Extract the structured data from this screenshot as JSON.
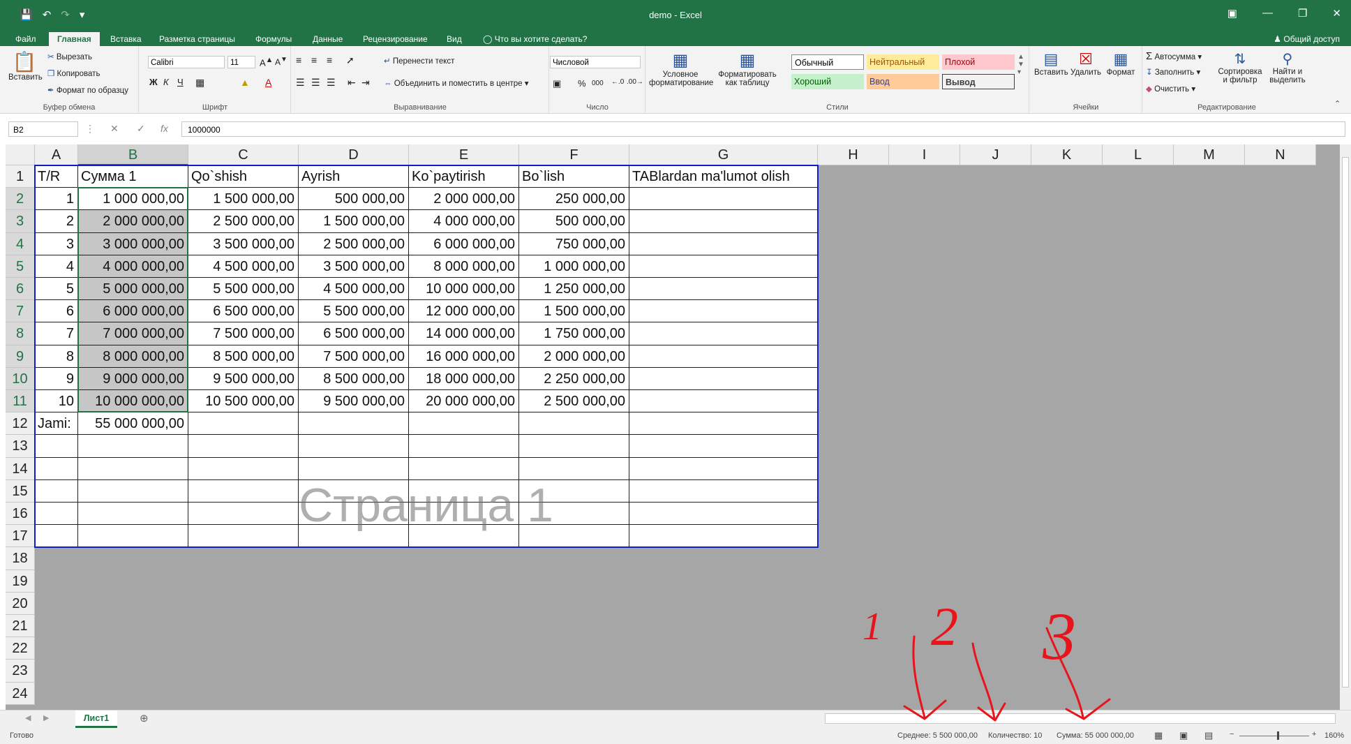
{
  "titlebar": {
    "title": "demo - Excel"
  },
  "tabs": [
    "Файл",
    "Главная",
    "Вставка",
    "Разметка страницы",
    "Формулы",
    "Данные",
    "Рецензирование",
    "Вид"
  ],
  "tellme": "Что вы хотите сделать?",
  "share": "Общий доступ",
  "ribbon": {
    "clipboard": {
      "paste": "Вставить",
      "cut": "Вырезать",
      "copy": "Копировать",
      "format_painter": "Формат по образцу",
      "label": "Буфер обмена"
    },
    "font": {
      "name": "Calibri",
      "size": "11",
      "bold": "Ж",
      "italic": "К",
      "underline": "Ч",
      "label": "Шрифт"
    },
    "alignment": {
      "wrap": "Перенести текст",
      "merge": "Объединить и поместить в центре",
      "label": "Выравнивание"
    },
    "number": {
      "format": "Числовой",
      "percent": "%",
      "thousands": "000",
      "label": "Число"
    },
    "styles": {
      "conditional": "Условное форматирование",
      "as_table": "Форматировать как таблицу",
      "normal": "Обычный",
      "neutral": "Нейтральный",
      "bad": "Плохой",
      "good": "Хороший",
      "input": "Ввод",
      "output": "Вывод",
      "label": "Стили"
    },
    "cells": {
      "insert": "Вставить",
      "delete": "Удалить",
      "format": "Формат",
      "label": "Ячейки"
    },
    "editing": {
      "autosum": "Автосумма",
      "fill": "Заполнить",
      "clear": "Очистить",
      "sort": "Сортировка и фильтр",
      "find": "Найти и выделить",
      "label": "Редактирование"
    }
  },
  "formula_bar": {
    "name_box": "B2",
    "fx": "fx",
    "value": "1000000"
  },
  "columns": [
    "A",
    "B",
    "C",
    "D",
    "E",
    "F",
    "G",
    "H",
    "I",
    "J",
    "K",
    "L",
    "M",
    "N"
  ],
  "rows": [
    "1",
    "2",
    "3",
    "4",
    "5",
    "6",
    "7",
    "8",
    "9",
    "10",
    "11",
    "12",
    "13",
    "14",
    "15",
    "16",
    "17",
    "18",
    "19",
    "20",
    "21",
    "22",
    "23",
    "24"
  ],
  "table": {
    "header": [
      "T/R",
      "Сумма 1",
      "Qo`shish",
      "Ayrish",
      "Ko`paytirish",
      "Bo`lish",
      "TABlardan ma'lumot olish"
    ],
    "data": [
      [
        "1",
        "1 000 000,00",
        "1 500 000,00",
        "500 000,00",
        "2 000 000,00",
        "250 000,00",
        ""
      ],
      [
        "2",
        "2 000 000,00",
        "2 500 000,00",
        "1 500 000,00",
        "4 000 000,00",
        "500 000,00",
        ""
      ],
      [
        "3",
        "3 000 000,00",
        "3 500 000,00",
        "2 500 000,00",
        "6 000 000,00",
        "750 000,00",
        ""
      ],
      [
        "4",
        "4 000 000,00",
        "4 500 000,00",
        "3 500 000,00",
        "8 000 000,00",
        "1 000 000,00",
        ""
      ],
      [
        "5",
        "5 000 000,00",
        "5 500 000,00",
        "4 500 000,00",
        "10 000 000,00",
        "1 250 000,00",
        ""
      ],
      [
        "6",
        "6 000 000,00",
        "6 500 000,00",
        "5 500 000,00",
        "12 000 000,00",
        "1 500 000,00",
        ""
      ],
      [
        "7",
        "7 000 000,00",
        "7 500 000,00",
        "6 500 000,00",
        "14 000 000,00",
        "1 750 000,00",
        ""
      ],
      [
        "8",
        "8 000 000,00",
        "8 500 000,00",
        "7 500 000,00",
        "16 000 000,00",
        "2 000 000,00",
        ""
      ],
      [
        "9",
        "9 000 000,00",
        "9 500 000,00",
        "8 500 000,00",
        "18 000 000,00",
        "2 250 000,00",
        ""
      ],
      [
        "10",
        "10 000 000,00",
        "10 500 000,00",
        "9 500 000,00",
        "20 000 000,00",
        "2 500 000,00",
        ""
      ]
    ],
    "total": [
      "Jami:",
      "55 000 000,00",
      "",
      "",
      "",
      "",
      ""
    ]
  },
  "watermark": "Страница 1",
  "sheet_tab": "Лист1",
  "status": {
    "ready": "Готово",
    "average": "Среднее: 5 500 000,00",
    "count": "Количество: 10",
    "sum": "Сумма: 55 000 000,00",
    "zoom": "160%"
  },
  "annotations": [
    "1",
    "2",
    "3"
  ]
}
